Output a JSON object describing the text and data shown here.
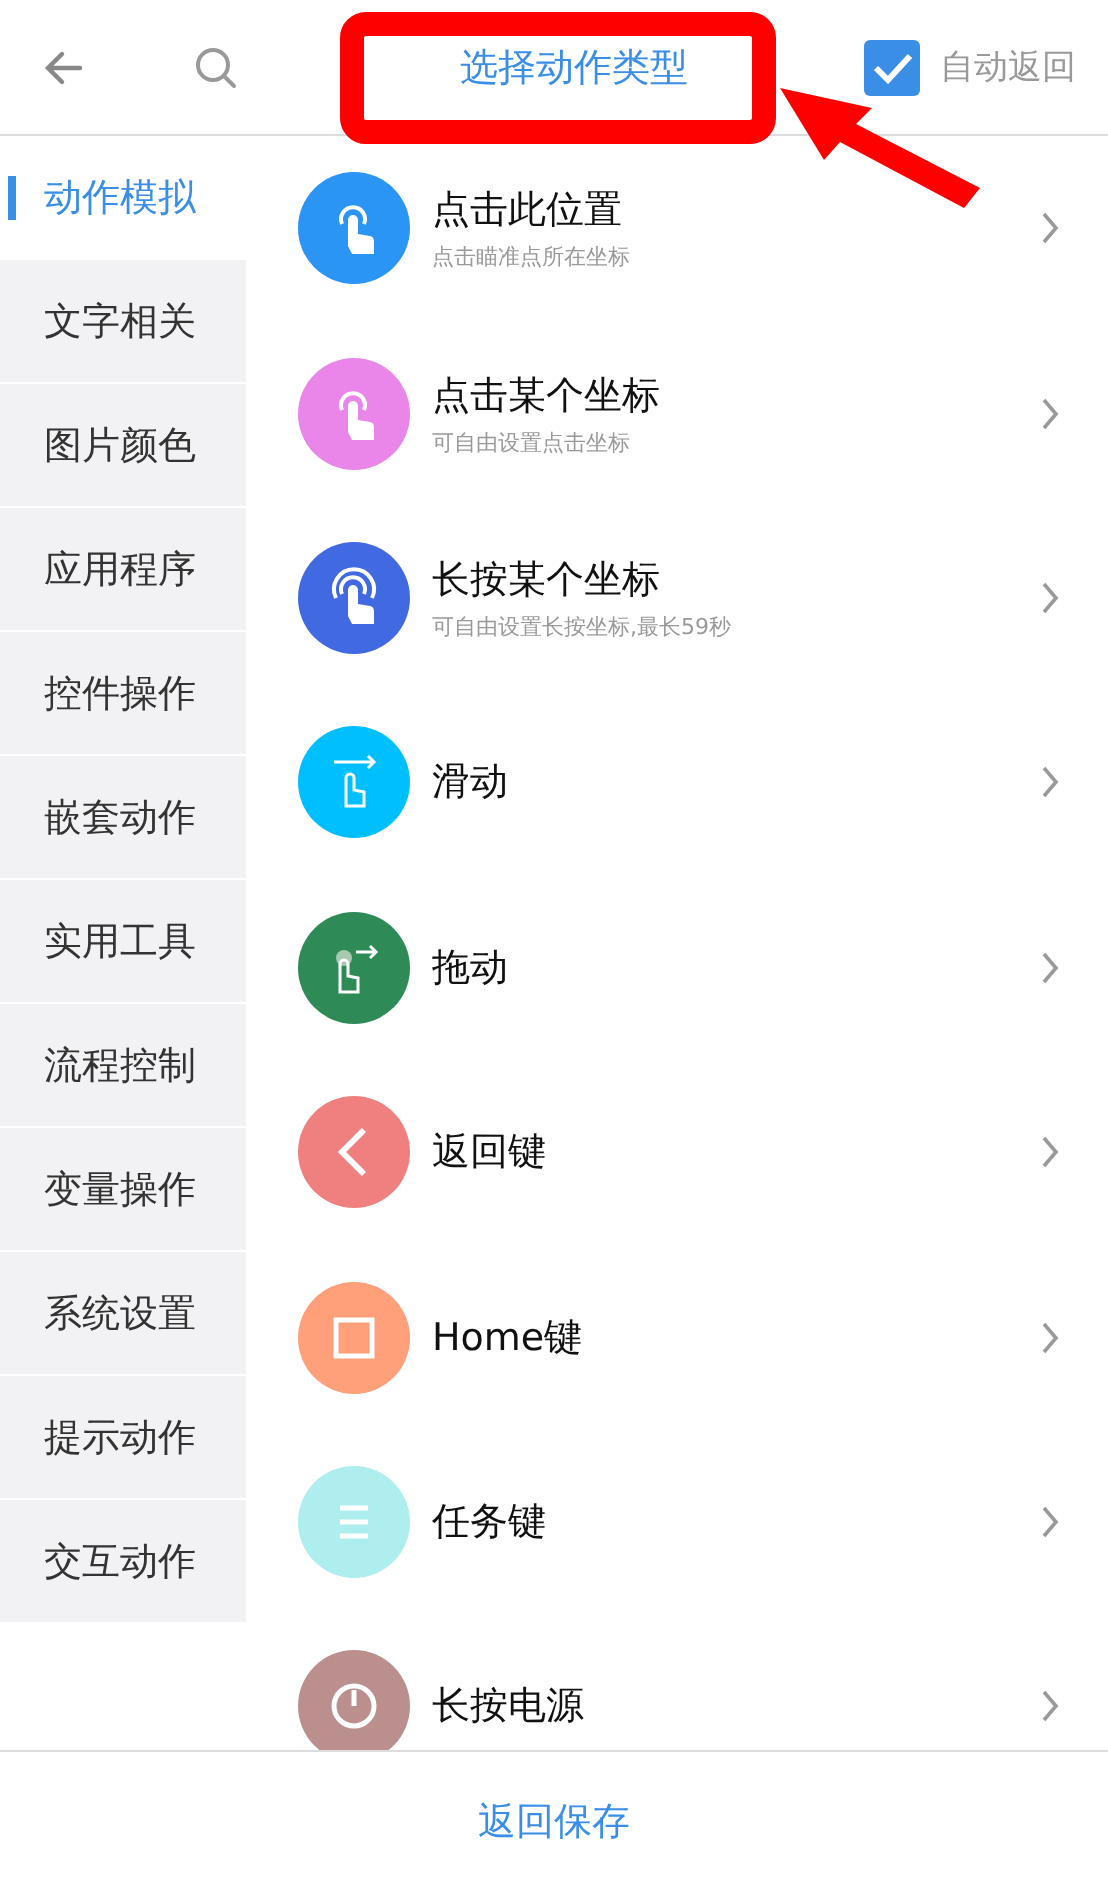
{
  "header": {
    "title": "选择动作类型",
    "auto_return": {
      "label": "自动返回",
      "checked": true
    }
  },
  "categories": [
    {
      "label": "动作模拟",
      "selected": true
    },
    {
      "label": "文字相关",
      "selected": false
    },
    {
      "label": "图片颜色",
      "selected": false
    },
    {
      "label": "应用程序",
      "selected": false
    },
    {
      "label": "控件操作",
      "selected": false
    },
    {
      "label": "嵌套动作",
      "selected": false
    },
    {
      "label": "实用工具",
      "selected": false
    },
    {
      "label": "流程控制",
      "selected": false
    },
    {
      "label": "变量操作",
      "selected": false
    },
    {
      "label": "系统设置",
      "selected": false
    },
    {
      "label": "提示动作",
      "selected": false
    },
    {
      "label": "交互动作",
      "selected": false
    }
  ],
  "actions": [
    {
      "kind": "tap",
      "color": "#2a95f5",
      "title": "点击此位置",
      "subtitle": "点击瞄准点所在坐标"
    },
    {
      "kind": "tap",
      "color": "#ea86ea",
      "title": "点击某个坐标",
      "subtitle": "可自由设置点击坐标"
    },
    {
      "kind": "press",
      "color": "#4169e1",
      "title": "长按某个坐标",
      "subtitle": "可自由设置长按坐标,最长59秒"
    },
    {
      "kind": "swipe",
      "color": "#00bfff",
      "title": "滑动"
    },
    {
      "kind": "drag",
      "color": "#2e8b57",
      "title": "拖动"
    },
    {
      "kind": "back",
      "color": "#f08080",
      "title": "返回键"
    },
    {
      "kind": "home",
      "color": "#ffa07a",
      "title": "Home键"
    },
    {
      "kind": "recents",
      "color": "#afeeee",
      "title": "任务键"
    },
    {
      "kind": "power",
      "color": "#bc8f8f",
      "title": "长按电源"
    }
  ],
  "footer": {
    "button": "返回保存"
  }
}
